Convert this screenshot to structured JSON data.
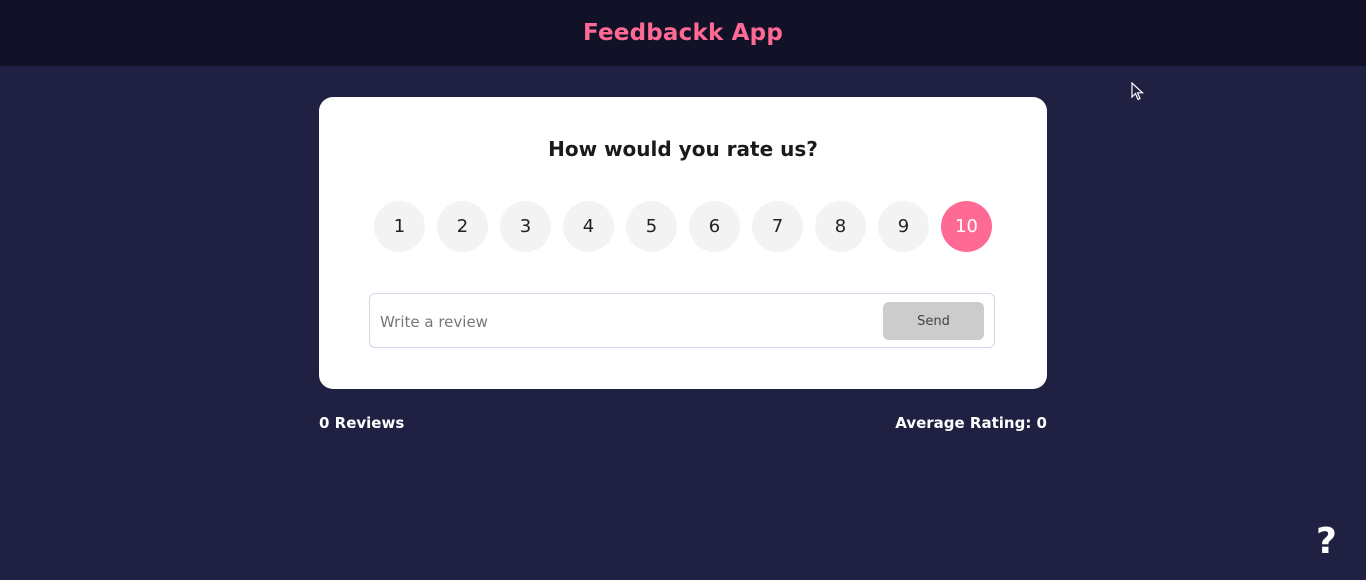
{
  "header": {
    "title": "Feedbackk App"
  },
  "card": {
    "question": "How would you rate us?",
    "ratings": [
      "1",
      "2",
      "3",
      "4",
      "5",
      "6",
      "7",
      "8",
      "9",
      "10"
    ],
    "selected_rating": "10",
    "review_input": {
      "placeholder": "Write a review",
      "value": ""
    },
    "send_label": "Send"
  },
  "stats": {
    "reviews": "0 Reviews",
    "average": "Average Rating: 0"
  },
  "help_label": "?",
  "colors": {
    "background": "#202142",
    "header": "#111127",
    "accent": "#ff6a95",
    "card": "#ffffff"
  },
  "icons": {
    "cursor": "mouse-cursor-icon",
    "help": "help-icon"
  }
}
